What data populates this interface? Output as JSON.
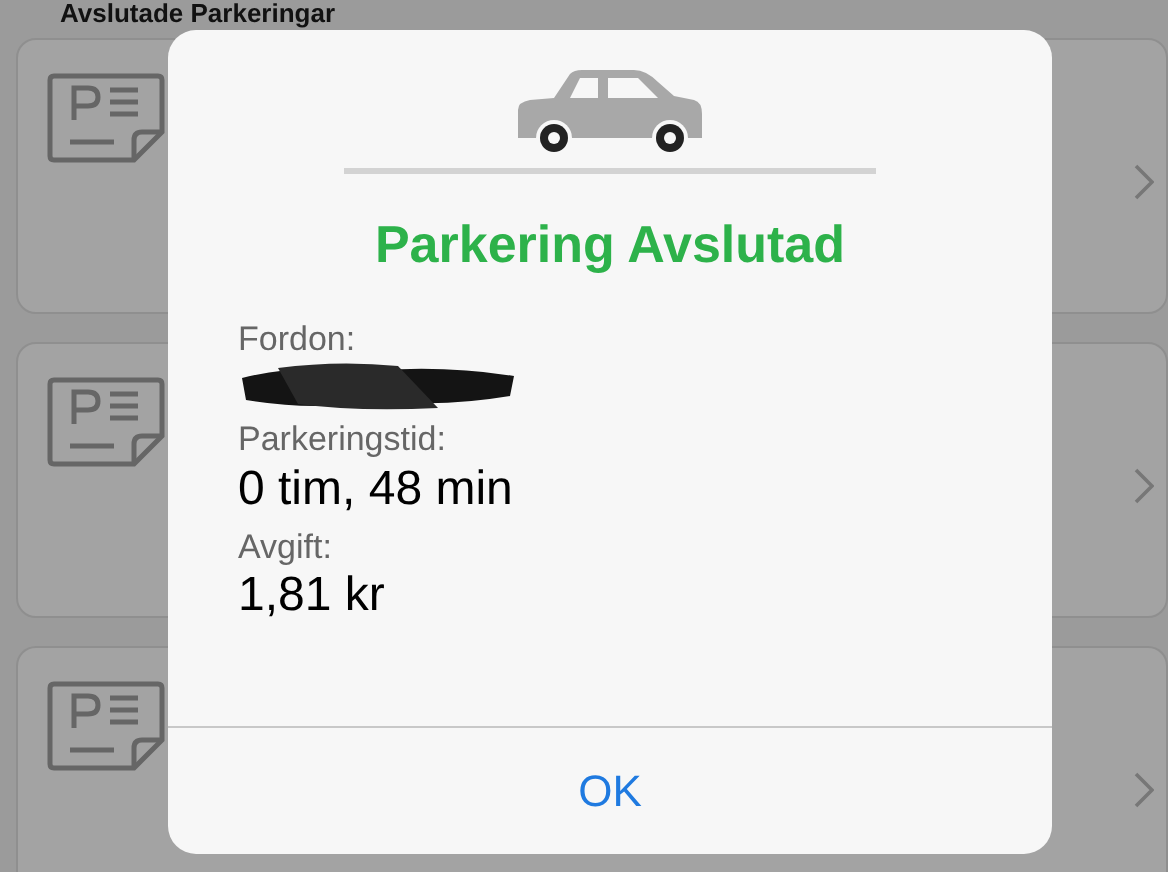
{
  "background": {
    "heading": "Avslutade Parkeringar",
    "items": [
      {
        "kind": "ticket"
      },
      {
        "kind": "ticket"
      },
      {
        "kind": "ticket"
      }
    ]
  },
  "dialog": {
    "title": "Parkering Avslutad",
    "fields": [
      {
        "kind": "redacted",
        "label": "Fordon:"
      },
      {
        "kind": "text",
        "label": "Parkeringstid:",
        "value": "0 tim, 48 min"
      },
      {
        "kind": "text",
        "label": "Avgift:",
        "value": "1,81 kr"
      }
    ],
    "button": "OK"
  }
}
